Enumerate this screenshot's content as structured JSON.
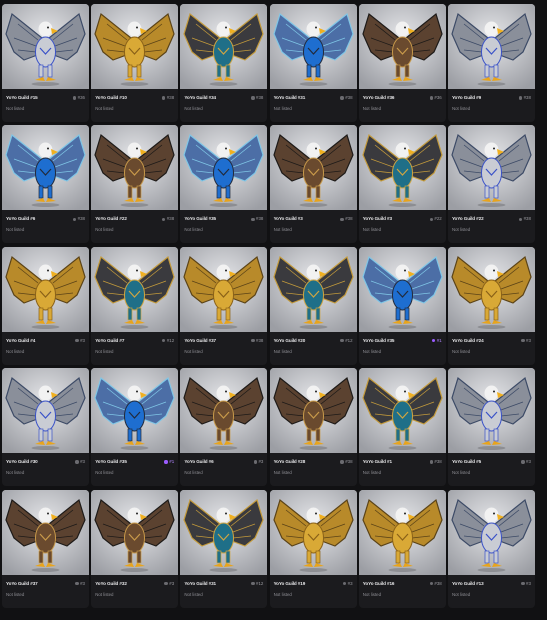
{
  "items": [
    {
      "name": "YoYo Guild #15",
      "rank": "#36",
      "status": "Not listed",
      "theme": "silver",
      "rare": false
    },
    {
      "name": "YoYo Guild #10",
      "rank": "#38",
      "status": "Not listed",
      "theme": "gold",
      "rare": false
    },
    {
      "name": "YoYo Guild #34",
      "rank": "#38",
      "status": "Not listed",
      "theme": "teal",
      "rare": false
    },
    {
      "name": "YoYo Guild #31",
      "rank": "#38",
      "status": "Not listed",
      "theme": "blue",
      "rare": false
    },
    {
      "name": "YoYo Guild #36",
      "rank": "#36",
      "status": "Not listed",
      "theme": "bronze",
      "rare": false
    },
    {
      "name": "YoYo Guild #9",
      "rank": "#38",
      "status": "Not listed",
      "theme": "silver",
      "rare": false
    },
    {
      "name": "YoYo Guild #6",
      "rank": "#38",
      "status": "Not listed",
      "theme": "blue",
      "rare": false
    },
    {
      "name": "YoYo Guild #22",
      "rank": "#38",
      "status": "Not listed",
      "theme": "bronze",
      "rare": false
    },
    {
      "name": "YoYo Guild #35",
      "rank": "#38",
      "status": "Not listed",
      "theme": "blue",
      "rare": false
    },
    {
      "name": "YoYo Guild #3",
      "rank": "#38",
      "status": "Not listed",
      "theme": "bronze",
      "rare": false
    },
    {
      "name": "YoYo Guild #3",
      "rank": "#22",
      "status": "Not listed",
      "theme": "teal",
      "rare": false
    },
    {
      "name": "YoYo Guild #22",
      "rank": "#38",
      "status": "Not listed",
      "theme": "silver",
      "rare": false
    },
    {
      "name": "YoYo Guild #4",
      "rank": "#3",
      "status": "Not listed",
      "theme": "gold",
      "rare": false
    },
    {
      "name": "YoYo Guild #7",
      "rank": "#12",
      "status": "Not listed",
      "theme": "teal",
      "rare": false
    },
    {
      "name": "YoYo Guild #37",
      "rank": "#38",
      "status": "Not listed",
      "theme": "gold",
      "rare": false
    },
    {
      "name": "YoYo Guild #20",
      "rank": "#12",
      "status": "Not listed",
      "theme": "teal",
      "rare": false
    },
    {
      "name": "YoYo Guild #35",
      "rank": "#1",
      "status": "Not listed",
      "theme": "blue",
      "rare": true
    },
    {
      "name": "YoYo Guild #24",
      "rank": "#3",
      "status": "Not listed",
      "theme": "gold",
      "rare": false
    },
    {
      "name": "YoYo Guild #30",
      "rank": "#3",
      "status": "Not listed",
      "theme": "silver",
      "rare": false
    },
    {
      "name": "YoYo Guild #35",
      "rank": "#1",
      "status": "Not listed",
      "theme": "blue",
      "rare": true
    },
    {
      "name": "YoYo Guild #6",
      "rank": "#3",
      "status": "Not listed",
      "theme": "bronze",
      "rare": false
    },
    {
      "name": "YoYo Guild #28",
      "rank": "#38",
      "status": "Not listed",
      "theme": "bronze",
      "rare": false
    },
    {
      "name": "YoYo Guild #1",
      "rank": "#38",
      "status": "Not listed",
      "theme": "teal",
      "rare": false
    },
    {
      "name": "YoYo Guild #5",
      "rank": "#3",
      "status": "Not listed",
      "theme": "silver",
      "rare": false
    },
    {
      "name": "YoYo Guild #37",
      "rank": "#3",
      "status": "Not listed",
      "theme": "bronze",
      "rare": false
    },
    {
      "name": "YoYo Guild #32",
      "rank": "#3",
      "status": "Not listed",
      "theme": "bronze",
      "rare": false
    },
    {
      "name": "YoYo Guild #31",
      "rank": "#12",
      "status": "Not listed",
      "theme": "teal",
      "rare": false
    },
    {
      "name": "YoYo Guild #19",
      "rank": "#3",
      "status": "Not listed",
      "theme": "gold",
      "rare": false
    },
    {
      "name": "YoYo Guild #16",
      "rank": "#38",
      "status": "Not listed",
      "theme": "gold",
      "rare": false
    },
    {
      "name": "YoYo Guild #13",
      "rank": "#3",
      "status": "Not listed",
      "theme": "silver",
      "rare": false
    }
  ],
  "themes": {
    "silver": {
      "wing": "#8a8f9a",
      "wingEdge": "#3c4a66",
      "body": "#c9ccd4",
      "trim": "#3a52c8"
    },
    "gold": {
      "wing": "#b88a2a",
      "wingEdge": "#5b4317",
      "body": "#d9a936",
      "trim": "#8a6118"
    },
    "teal": {
      "wing": "#3a3a3e",
      "wingEdge": "#c39a3b",
      "body": "#1f6f88",
      "trim": "#d0a542"
    },
    "blue": {
      "wing": "#4c6ea6",
      "wingEdge": "#7fc6e6",
      "body": "#1e6ed0",
      "trim": "#222a3a"
    },
    "bronze": {
      "wing": "#5b4230",
      "wingEdge": "#1d1a18",
      "body": "#6a4a2e",
      "trim": "#c89a4a"
    }
  }
}
